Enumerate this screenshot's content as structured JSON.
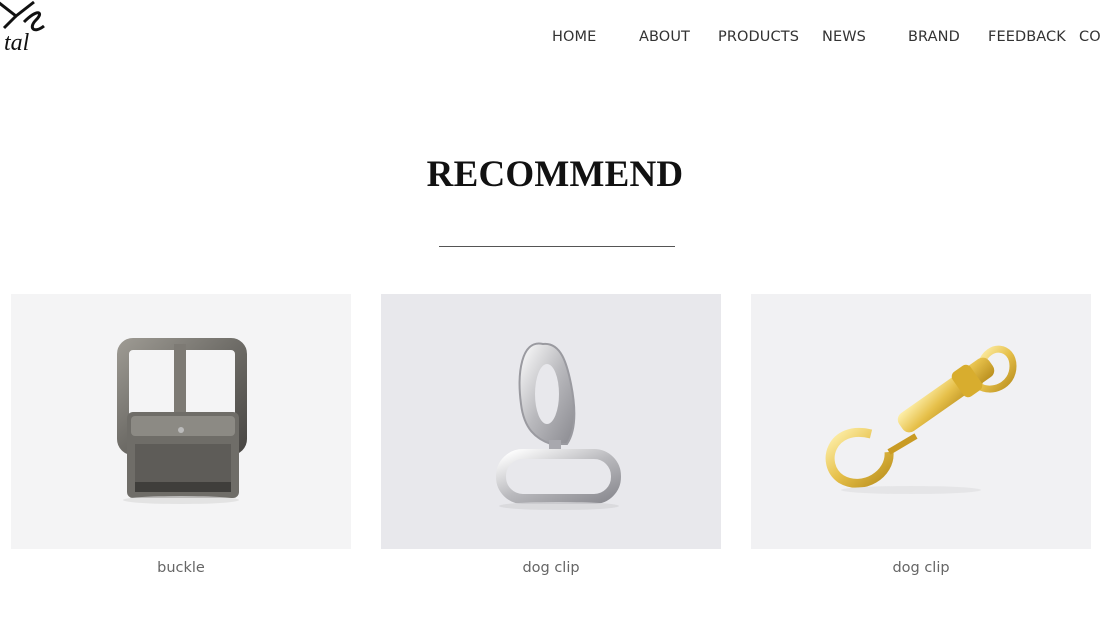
{
  "nav": {
    "items": [
      "HOME",
      "ABOUT",
      "PRODUCTS",
      "NEWS",
      "BRAND",
      "FEEDBACK",
      "CO"
    ]
  },
  "logo": {
    "text": "tal"
  },
  "section": {
    "title": "RECOMMEND"
  },
  "products": [
    {
      "name": "buckle",
      "icon": "belt-buckle-image",
      "bg": "#f4f4f5"
    },
    {
      "name": "dog clip",
      "icon": "silver-dog-clip-image",
      "bg": "#e8e8ec"
    },
    {
      "name": "dog clip",
      "icon": "gold-dog-clip-image",
      "bg": "#f1f1f3"
    }
  ]
}
